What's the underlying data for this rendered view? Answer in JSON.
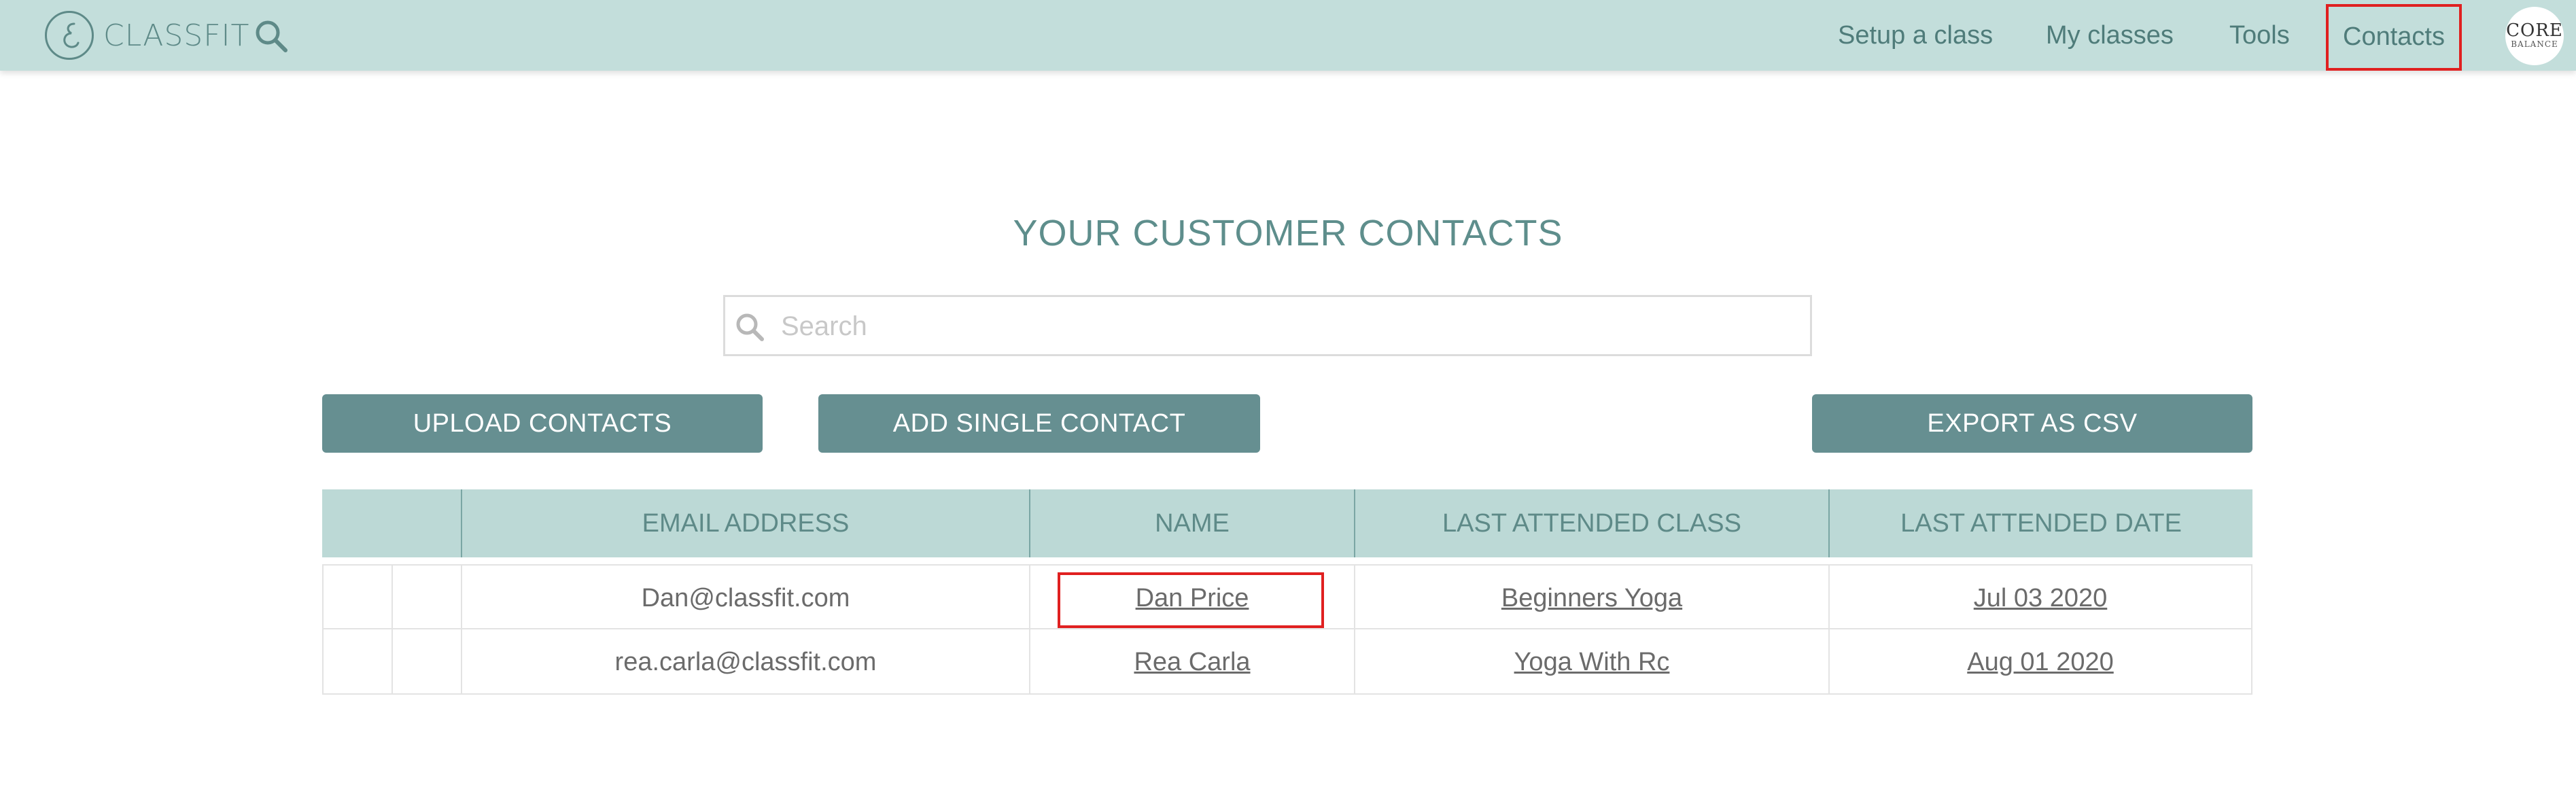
{
  "brand": {
    "name": "CLASSFIT",
    "accent_color": "#c3dedb",
    "button_color": "#668f91"
  },
  "nav": {
    "items": [
      {
        "label": "Setup a class"
      },
      {
        "label": "My classes"
      },
      {
        "label": "Tools"
      },
      {
        "label": "Contacts"
      }
    ]
  },
  "avatar": {
    "line1": "CORE",
    "line2": "BALANCE"
  },
  "page": {
    "title": "YOUR CUSTOMER CONTACTS"
  },
  "search": {
    "placeholder": "Search",
    "value": ""
  },
  "actions": {
    "upload_label": "UPLOAD CONTACTS",
    "add_label": "ADD SINGLE CONTACT",
    "export_label": "EXPORT AS CSV"
  },
  "table": {
    "columns": [
      "",
      "EMAIL ADDRESS",
      "NAME",
      "LAST ATTENDED CLASS",
      "LAST ATTENDED DATE"
    ],
    "rows": [
      {
        "email": "Dan@classfit.com",
        "name": "Dan Price",
        "last_class": "Beginners Yoga",
        "last_date": "Jul 03 2020"
      },
      {
        "email": "rea.carla@classfit.com",
        "name": "Rea Carla",
        "last_class": "Yoga With Rc",
        "last_date": "Aug 01 2020"
      }
    ]
  },
  "icons": {
    "logo": "classfit-logo-icon",
    "search": "search-icon"
  }
}
